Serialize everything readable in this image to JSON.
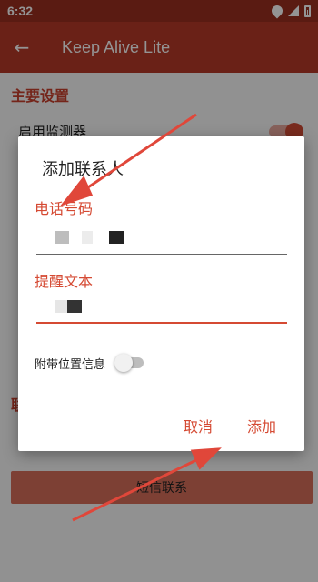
{
  "status_bar": {
    "time": "6:32"
  },
  "app_bar": {
    "title": "Keep Alive Lite"
  },
  "background": {
    "section_main": "主要设置",
    "row_monitor": "启用监测器",
    "section_other": "联",
    "bottom_button": "短信联系"
  },
  "dialog": {
    "title": "添加联系人",
    "phone_label": "电话号码",
    "remind_label": "提醒文本",
    "location_label": "附带位置信息",
    "location_enabled": false,
    "cancel": "取消",
    "add": "添加"
  },
  "colors": {
    "accent": "#d54a33",
    "app_bar": "#b73a28",
    "status_bar": "#9b2f20",
    "arrow": "#e0473a"
  },
  "icons": [
    "back-arrow-icon",
    "wifi-icon",
    "signal-icon",
    "battery-icon"
  ]
}
